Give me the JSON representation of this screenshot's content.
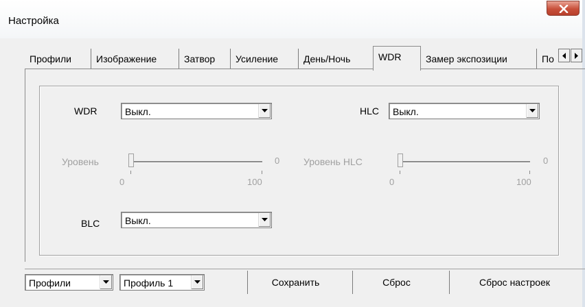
{
  "window": {
    "title": "Настройка"
  },
  "tabs": [
    {
      "label": "Профили"
    },
    {
      "label": "Изображение"
    },
    {
      "label": "Затвор"
    },
    {
      "label": "Усиление"
    },
    {
      "label": "День/Ночь"
    },
    {
      "label": "WDR",
      "active": true
    },
    {
      "label": "Замер экспозиции"
    },
    {
      "label": "По"
    }
  ],
  "wdr": {
    "label": "WDR",
    "value": "Выкл.",
    "level_label": "Уровень",
    "level_value": "0",
    "level_min": "0",
    "level_max": "100"
  },
  "hlc": {
    "label": "HLC",
    "value": "Выкл.",
    "level_label": "Уровень HLC",
    "level_value": "0",
    "level_min": "0",
    "level_max": "100"
  },
  "blc": {
    "label": "BLC",
    "value": "Выкл."
  },
  "bottom": {
    "profiles_select": "Профили",
    "profile_select": "Профиль 1",
    "save_label": "Сохранить",
    "reset_label": "Сброс",
    "reset_settings_label": "Сброс настроек"
  },
  "icons": [
    "close-icon",
    "arrow-left-icon",
    "arrow-right-icon",
    "chevron-down-icon"
  ],
  "colors": {
    "close_button": "#c8503b",
    "disabled_text": "#a0a0a0"
  }
}
